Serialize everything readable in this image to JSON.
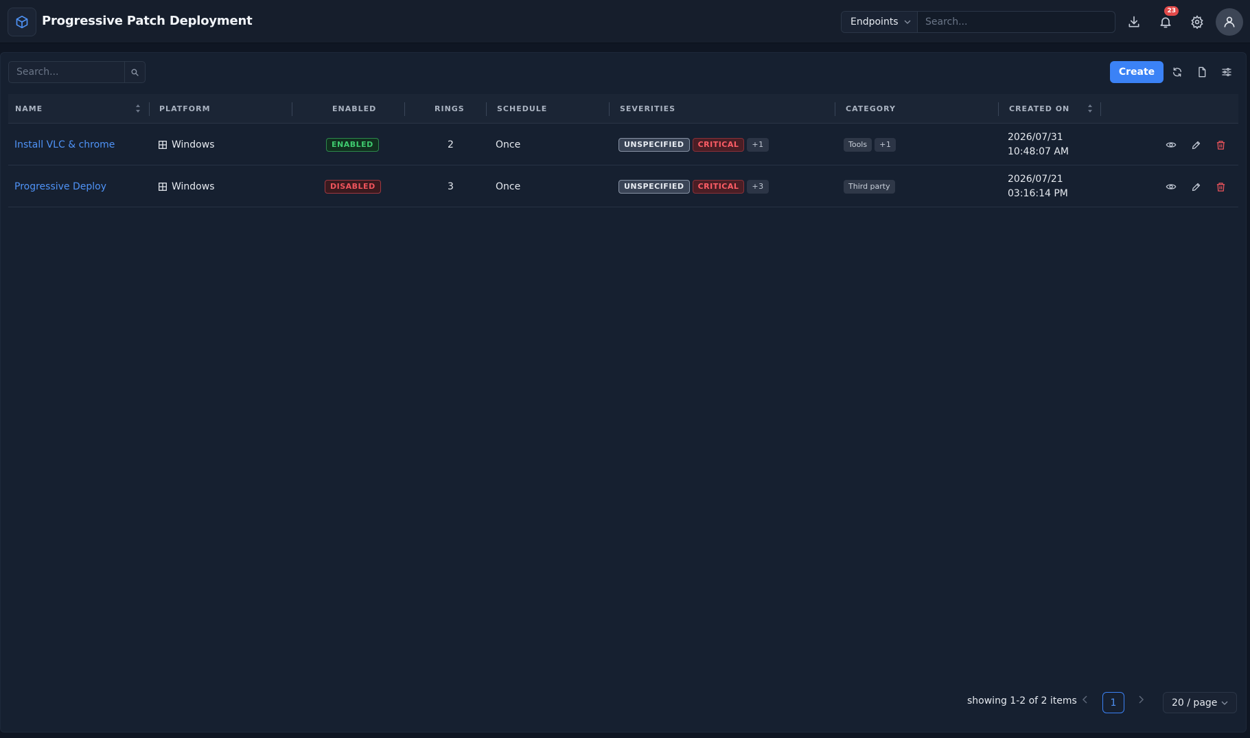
{
  "header": {
    "title": "Progressive Patch Deployment",
    "scope_select": "Endpoints",
    "search_placeholder": "Search...",
    "notification_count": "23"
  },
  "toolbar": {
    "search_placeholder": "Search...",
    "create_label": "Create"
  },
  "table": {
    "columns": {
      "name": "NAME",
      "platform": "PLATFORM",
      "enabled": "ENABLED",
      "rings": "RINGS",
      "schedule": "SCHEDULE",
      "severities": "SEVERITIES",
      "category": "CATEGORY",
      "created_on": "CREATED ON"
    },
    "rows": [
      {
        "name": "Install VLC & chrome",
        "platform": "Windows",
        "enabled": "ENABLED",
        "rings": "2",
        "schedule": "Once",
        "sev1": "UNSPECIFIED",
        "sev2": "CRITICAL",
        "sev_more": "+1",
        "cat1": "Tools",
        "cat_more": "+1",
        "created_on": "2026/07/31 10:48:07 AM"
      },
      {
        "name": "Progressive Deploy",
        "platform": "Windows",
        "enabled": "DISABLED",
        "rings": "3",
        "schedule": "Once",
        "sev1": "UNSPECIFIED",
        "sev2": "CRITICAL",
        "sev_more": "+3",
        "cat1": "Third party",
        "created_on": "2026/07/21 03:16:14 PM"
      }
    ]
  },
  "pagination": {
    "info": "showing 1-2 of 2 items",
    "current_page": "1",
    "page_size": "20 / page"
  },
  "colors": {
    "accent": "#3b82f6",
    "enabled": "#3fcb6f",
    "danger": "#f0545c"
  }
}
